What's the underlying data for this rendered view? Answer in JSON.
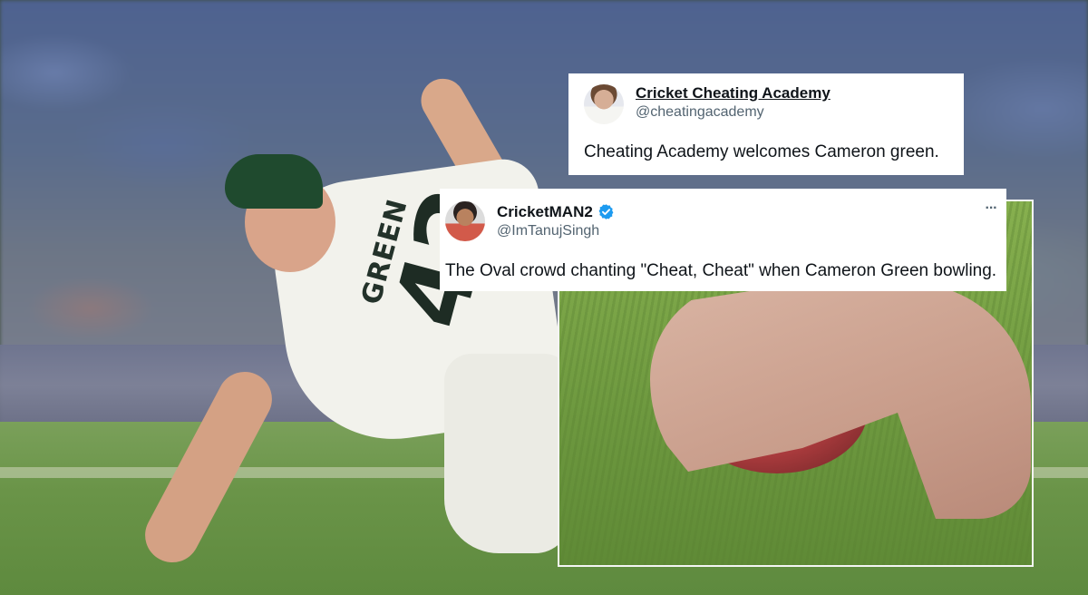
{
  "scene": {
    "jersey_name": "GREEN",
    "jersey_number": "42"
  },
  "tweets": [
    {
      "display_name": "Cricket Cheating Academy",
      "handle": "@cheatingacademy",
      "text": "Cheating Academy welcomes Cameron green.",
      "verified": false
    },
    {
      "display_name": "CricketMAN2",
      "handle": "@ImTanujSingh",
      "text": "The Oval crowd chanting \"Cheat, Cheat\" when Cameron Green bowling.",
      "verified": true,
      "more_label": "···"
    }
  ],
  "colors": {
    "card_bg": "#ffffff",
    "text_primary": "#0f1419",
    "text_secondary": "#536471",
    "verified_blue": "#1d9bf0"
  },
  "icons": {
    "verified": "verified-badge-icon",
    "more": "more-options-icon"
  }
}
